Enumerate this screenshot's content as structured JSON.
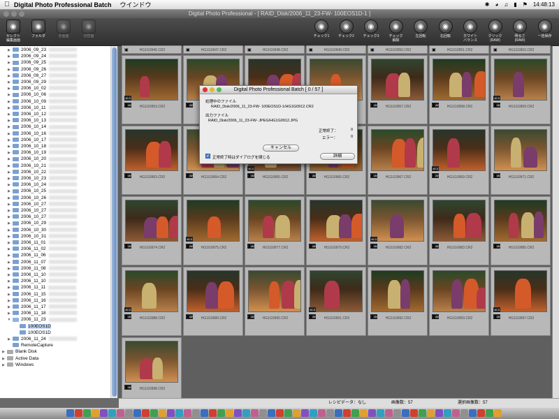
{
  "menubar": {
    "app_name": "Digital Photo Professional Batch",
    "menu_window": "ウインドウ",
    "clock": "14:48:13",
    "icons": [
      "apple-icon",
      "bluetooth-icon",
      "airport-icon",
      "volume-icon",
      "battery-icon",
      "flag-icon"
    ]
  },
  "window": {
    "title": "Digital Photo Professional - [ RAID_Disk/2006_11_23-FW-                          100EOS1D-1 ]"
  },
  "toolbar": {
    "left": [
      {
        "label": "セレクト\n編集画面",
        "icon": "select-edit-icon"
      },
      {
        "label": "フォルダ",
        "icon": "folder-icon"
      },
      {
        "label": "全画面",
        "icon": "fullscreen-icon"
      },
      {
        "label": "切替面",
        "icon": "switch-view-icon"
      }
    ],
    "right": [
      {
        "label": "チェック1",
        "icon": "check1-icon"
      },
      {
        "label": "チェック2",
        "icon": "check2-icon"
      },
      {
        "label": "チェック3",
        "icon": "check3-icon"
      },
      {
        "label": "チェック\n解除",
        "icon": "uncheck-icon"
      },
      {
        "label": "左回転",
        "icon": "rotate-left-icon"
      },
      {
        "label": "右回転",
        "icon": "rotate-right-icon"
      },
      {
        "label": "ホワイト\nバランス",
        "icon": "white-balance-icon"
      },
      {
        "label": "クリック\n(RAW)",
        "icon": "click-wb-icon"
      },
      {
        "label": "明るさ\n(RAW)",
        "icon": "brightness-icon"
      },
      {
        "label": "一括保存",
        "icon": "batch-save-icon"
      }
    ]
  },
  "sidebar": {
    "folders": [
      "2006_09_23",
      "2006_09_24",
      "2006_09_25",
      "2006_09_26",
      "2006_09_27",
      "2006_09_29",
      "2006_10_02",
      "2006_10_06",
      "2006_10_09",
      "2006_10_11",
      "2006_10_12",
      "2006_10_13",
      "2006_10_14",
      "2006_10_16",
      "2006_10_17",
      "2006_10_18",
      "2006_10_19",
      "2006_10_20",
      "2006_10_21",
      "2006_10_22",
      "2006_10_23",
      "2006_10_24",
      "2006_10_25",
      "2006_10_26",
      "2006_10_27",
      "2006_10_27",
      "2006_10_27",
      "2006_10_29",
      "2006_10_30",
      "2006_10_31",
      "2006_11_01",
      "2006_11_02",
      "2006_11_06",
      "2006_11_07",
      "2006_11_08",
      "2006_11_10",
      "2006_11_10",
      "2006_11_11",
      "2006_11_15",
      "2006_11_16",
      "2006_11_17",
      "2006_11_18",
      "2006_11_23"
    ],
    "subfolders": [
      "100EOS1D",
      "100EOS1D"
    ],
    "after": [
      "2006_11_24",
      "RemoteCapture"
    ],
    "volumes": [
      "Blank Disk",
      "Active Data",
      "Windows"
    ],
    "selected_subfolder": 0
  },
  "grid": {
    "top_captions": [
      "HG1G0946.CR2",
      "HG1G0947.CR2",
      "HG1G0948.CR2",
      "HG1G0949.CR2",
      "HG1G0950.CR2",
      "HG1G0951.CR2",
      "HG1G0952.CR2"
    ],
    "captions": [
      "HG1G0953.CR2",
      "HG1G0954.CR2",
      "HG1G0955.CR2",
      "HG1G0956.CR2",
      "HG1G0957.CR2",
      "HG1G0958.CR2",
      "HG1G0959.CR2",
      "HG1G0963.CR2",
      "HG1G0964.CR2",
      "HG1G0965.CR2",
      "HG1G0966.CR2",
      "HG1G0967.CR2",
      "HG1G0969.CR2",
      "HG1G0971.CR2",
      "HG1G0974.CR2",
      "HG1G0975.CR2",
      "HG1G0977.CR2",
      "HG1G0979.CR2",
      "HG1G0982.CR2",
      "HG1G0983.CR2",
      "HG1G0985.CR2",
      "HG1G0988.CR2",
      "HG1G0989.CR2",
      "HG1G0990.CR2",
      "HG1G0991.CR2",
      "HG1G0992.CR2",
      "HG1G0993.CR2",
      "HG1G0997.CR2",
      "HG1G0998.CR2"
    ],
    "badge": "RAW",
    "adj": "±0.3"
  },
  "dialog": {
    "title": "Digital Photo Professional Batch [ 0 / 57 ]",
    "processing_label": "処理中のファイル",
    "processing_file": "RAID_Disk/2006_11_23-FW-                        100EOS1D-1/HG1G0912.CR2",
    "output_label": "出力ファイル",
    "output_file": "RAID_Disk/2006_11_23-FW-                  JPEG/HG1G0912.JPG",
    "done_label": "正常終了：",
    "done_count": "0",
    "error_label": "エラー：",
    "error_count": "0",
    "cancel_label": "キャンセル",
    "checkbox_label": "正常終了時はダイアログを閉じる",
    "checkbox_checked": true,
    "details_label": "詳細"
  },
  "status": {
    "recipe": "レシピデータ：なし",
    "image_count": "画像数：57",
    "selected_count": "選択画像数：57"
  }
}
